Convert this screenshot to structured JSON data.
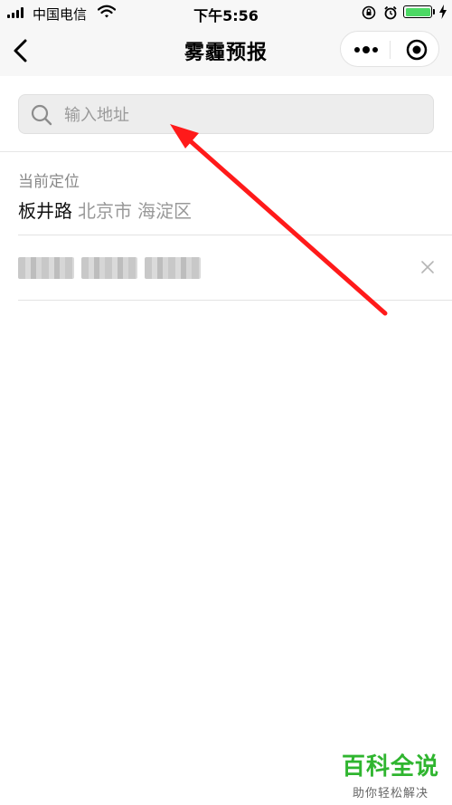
{
  "status_bar": {
    "carrier": "中国电信",
    "time": "下午5:56",
    "icons": [
      "signal-icon",
      "wifi-icon",
      "rotation-lock-icon",
      "alarm-icon",
      "battery-icon",
      "charging-icon"
    ],
    "battery_color": "#4cd964"
  },
  "nav": {
    "title": "雾霾预报",
    "back_icon": "chevron-left-icon",
    "menu_icons": [
      "more-icon",
      "target-icon"
    ]
  },
  "search": {
    "placeholder": "输入地址",
    "value": "",
    "icon": "search-icon"
  },
  "current_location": {
    "label": "当前定位",
    "road": "板井路",
    "city": "北京市",
    "district": "海淀区"
  },
  "history": {
    "items": [
      {
        "text_blurred": true,
        "delete_icon": "close-icon"
      }
    ]
  },
  "annotation": {
    "arrow_color": "#ff1a1a"
  },
  "watermark": {
    "main": "百科全说",
    "sub": "助你轻松解决",
    "color": "#2fb52f"
  }
}
